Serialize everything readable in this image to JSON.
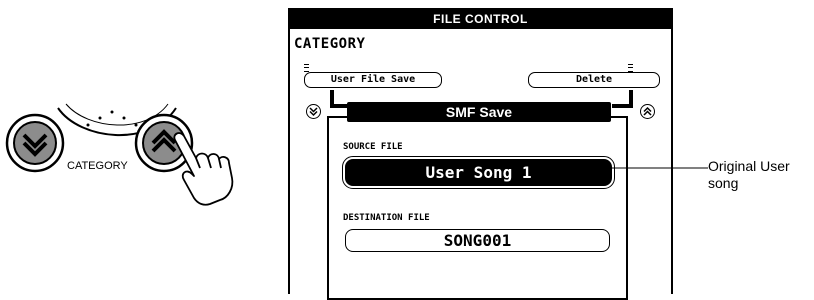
{
  "hand_panel": {
    "category_label": "CATEGORY",
    "down_button_icon": "double-chevron-down-icon",
    "up_button_icon": "double-chevron-up-icon",
    "hand_icon": "pointing-hand-icon"
  },
  "lcd": {
    "header_title": "FILE CONTROL",
    "category_title": "CATEGORY",
    "left_item": "User File Save",
    "right_item": "Delete",
    "selected_mode": "SMF Save",
    "left_nav_icon": "circle-chevron-down-icon",
    "right_nav_icon": "circle-chevron-up-icon",
    "source_label": "SOURCE FILE",
    "source_value": "User Song 1",
    "destination_label": "DESTINATION FILE",
    "destination_value": "SONG001"
  },
  "callout": {
    "line1": "Original User",
    "line2": "song"
  },
  "colors": {
    "ink": "#000000",
    "button_gray": "#8c8c8c",
    "background": "#ffffff"
  }
}
